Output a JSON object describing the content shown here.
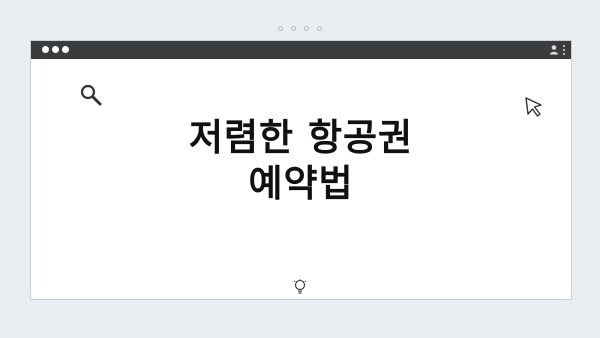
{
  "pager": {
    "dot_count": 4
  },
  "window": {
    "title_lines": [
      "저렴한 항공권",
      "예약법"
    ]
  },
  "icons": {
    "search": "search-icon",
    "cursor": "cursor-icon",
    "lightbulb": "lightbulb-icon",
    "user": "user-icon",
    "menu": "kebab-menu-icon"
  },
  "colors": {
    "background": "#e9eef2",
    "titlebar": "#3c3c3c",
    "window": "#ffffff",
    "text": "#111111"
  }
}
